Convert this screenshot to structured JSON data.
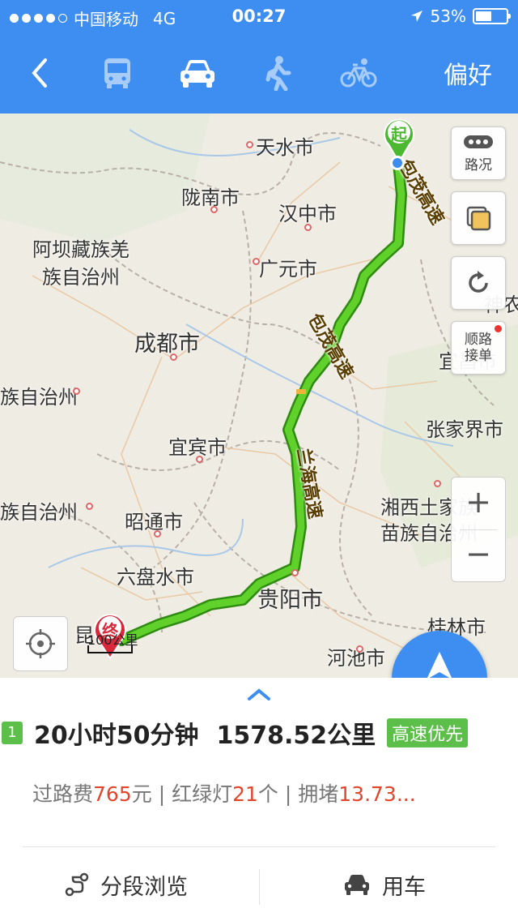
{
  "status_bar": {
    "carrier": "中国移动",
    "network": "4G",
    "time": "00:27",
    "battery": "53%",
    "battery_level": 0.53
  },
  "nav": {
    "back_icon": "chevron-left-icon",
    "modes": [
      {
        "name": "bus",
        "icon": "bus-icon",
        "selected": false
      },
      {
        "name": "car",
        "icon": "car-icon",
        "selected": true
      },
      {
        "name": "walk",
        "icon": "walk-icon",
        "selected": false
      },
      {
        "name": "bike",
        "icon": "bike-icon",
        "selected": false
      }
    ],
    "preference": "偏好"
  },
  "map": {
    "cities": [
      "天水市",
      "陇南市",
      "汉中市",
      "阿坝藏族羌",
      "族自治州",
      "广元市",
      "成都市",
      "宜昌市",
      "族自治州",
      "张家界市",
      "宜宾市",
      "族自治州",
      "湘西土家族",
      "苗族自治州",
      "昭通市",
      "六盘水市",
      "贵阳市",
      "桂林市",
      "河池市",
      "神农"
    ],
    "highways": [
      "包茂高速",
      "包茂高速",
      "兰海高速"
    ],
    "start_marker": "起",
    "end_marker": "终",
    "scale": "100公里",
    "buttons": {
      "traffic": "路况",
      "layers": "",
      "refresh": "",
      "order": "顺路接单"
    },
    "zoom_in": "+",
    "zoom_out": "−",
    "navigate": "导航",
    "colors": {
      "route": "#4ec21e",
      "route_outline": "#2f8a12",
      "accent": "#3d8ef0"
    }
  },
  "route": {
    "index": "1",
    "duration": "20小时50分钟",
    "distance": "1578.52公里",
    "tag": "高速优先",
    "toll_label": "过路费",
    "toll": "765",
    "toll_unit": "元",
    "sep1": " | ",
    "lights_label": "红绿灯",
    "lights": "21",
    "lights_unit": "个",
    "sep2": " | ",
    "jam_label": "拥堵",
    "jam": "13.73..."
  },
  "actions": {
    "segments": "分段浏览",
    "use_car": "用车"
  }
}
